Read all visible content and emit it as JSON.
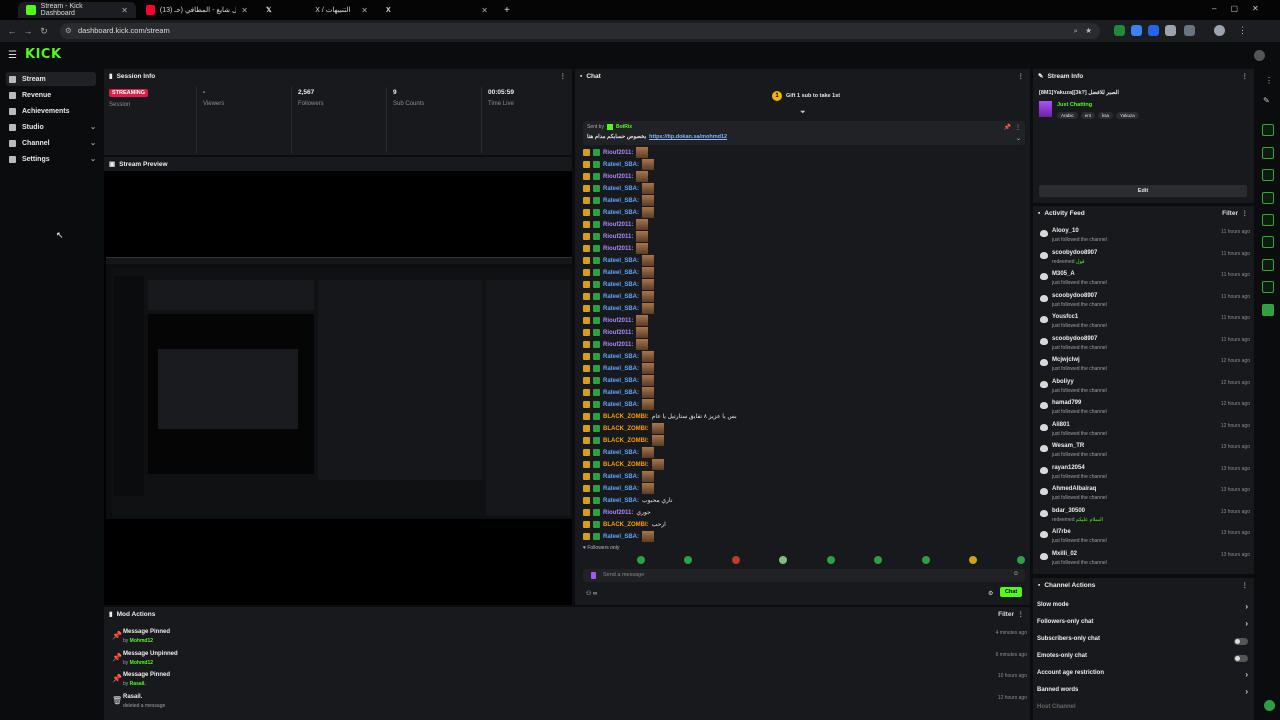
{
  "browser": {
    "tabs": [
      {
        "label": "Stream - Kick Dashboard",
        "color": "#53fc18"
      },
      {
        "label": "(13) مشعل شايع - المطافي (حـ...",
        "color": "#ff0033"
      },
      {
        "label": "X / التنبيهات",
        "color": "#ffffff"
      },
      {
        "label": "X",
        "color": "#ffffff"
      }
    ],
    "new_tab": "+",
    "url": "dashboard.kick.com/stream"
  },
  "logo": "KICK",
  "sidebar": {
    "items": [
      {
        "label": "Stream",
        "active": true
      },
      {
        "label": "Revenue"
      },
      {
        "label": "Achievements"
      },
      {
        "label": "Studio",
        "chevron": true
      },
      {
        "label": "Channel",
        "chevron": true
      },
      {
        "label": "Settings",
        "chevron": true
      }
    ]
  },
  "session_info": {
    "title": "Session Info",
    "badge": "STREAMING",
    "session_label": "Session",
    "stats": [
      {
        "value": "-",
        "label": "Viewers"
      },
      {
        "value": "2,567",
        "label": "Followers"
      },
      {
        "value": "9",
        "label": "Sub Counts"
      },
      {
        "value": "00:05:59",
        "label": "Time Live"
      }
    ]
  },
  "stream_preview": {
    "title": "Stream Preview"
  },
  "chat": {
    "title": "Chat",
    "gift_text": "Gift 1 sub to take 1st",
    "pinned_sender": "Sent by",
    "pinned_bot": "BotRix",
    "pinned_message": "بخصوص حسابكم مدام هنا",
    "pinned_link": "https://tip.dokan.sa/mohmd12",
    "rows": [
      {
        "name": "Riouf2011:",
        "color": "#a78bfa"
      },
      {
        "name": "Rateel_SBA:",
        "color": "#60a5fa"
      },
      {
        "name": "Riouf2011:",
        "color": "#a78bfa"
      },
      {
        "name": "Rateel_SBA:",
        "color": "#60a5fa"
      },
      {
        "name": "Rateel_SBA:",
        "color": "#60a5fa"
      },
      {
        "name": "Rateel_SBA:",
        "color": "#60a5fa"
      },
      {
        "name": "Riouf2011:",
        "color": "#a78bfa"
      },
      {
        "name": "Riouf2011:",
        "color": "#a78bfa"
      },
      {
        "name": "Riouf2011:",
        "color": "#a78bfa"
      },
      {
        "name": "Rateel_SBA:",
        "color": "#60a5fa"
      },
      {
        "name": "Rateel_SBA:",
        "color": "#60a5fa"
      },
      {
        "name": "Rateel_SBA:",
        "color": "#60a5fa"
      },
      {
        "name": "Rateel_SBA:",
        "color": "#60a5fa"
      },
      {
        "name": "Rateel_SBA:",
        "color": "#60a5fa"
      },
      {
        "name": "Riouf2011:",
        "color": "#a78bfa"
      },
      {
        "name": "Riouf2011:",
        "color": "#a78bfa"
      },
      {
        "name": "Riouf2011:",
        "color": "#a78bfa"
      },
      {
        "name": "Rateel_SBA:",
        "color": "#60a5fa"
      },
      {
        "name": "Rateel_SBA:",
        "color": "#60a5fa"
      },
      {
        "name": "Rateel_SBA:",
        "color": "#60a5fa"
      },
      {
        "name": "Rateel_SBA:",
        "color": "#60a5fa"
      },
      {
        "name": "Rateel_SBA:",
        "color": "#60a5fa"
      },
      {
        "name": "BLACK_ZOMBI:",
        "color": "#f59e0b",
        "text": "بس يا عزيز ٨ تقايق ستارتيل يا عام"
      },
      {
        "name": "BLACK_ZOMBI:",
        "color": "#f59e0b"
      },
      {
        "name": "BLACK_ZOMBI:",
        "color": "#f59e0b"
      },
      {
        "name": "Rateel_SBA:",
        "color": "#60a5fa"
      },
      {
        "name": "BLACK_ZOMBI:",
        "color": "#f59e0b"
      },
      {
        "name": "Rateel_SBA:",
        "color": "#60a5fa"
      },
      {
        "name": "Rateel_SBA:",
        "color": "#60a5fa"
      },
      {
        "name": "Rateel_SBA:",
        "color": "#60a5fa",
        "text": "تاري محبوب"
      },
      {
        "name": "Riouf2011:",
        "color": "#a78bfa",
        "text": "جوري"
      },
      {
        "name": "BLACK_ZOMBI:",
        "color": "#f59e0b",
        "text": "ارحب"
      },
      {
        "name": "Rateel_SBA:",
        "color": "#60a5fa"
      }
    ],
    "followers_only": "Followers only",
    "input_placeholder": "Send a message",
    "send_label": "Chat"
  },
  "stream_info": {
    "title": "Stream Info",
    "stream_title": "[8M1]Yakuza|[3k?] الصبر للافضل",
    "category": "Just Chatting",
    "tags": [
      "Arabic",
      "ent",
      "ksa",
      "Yakuza"
    ],
    "edit_label": "Edit"
  },
  "activity_feed": {
    "title": "Activity Feed",
    "filter_label": "Filter",
    "items": [
      {
        "name": "Alooy_10",
        "desc": "just followed the channel",
        "time": "11 hours ago"
      },
      {
        "name": "scoobydoo8907",
        "desc": "redeemed",
        "reward": "قول",
        "time": "11 hours ago"
      },
      {
        "name": "M305_A",
        "desc": "just followed the channel",
        "time": "11 hours ago"
      },
      {
        "name": "scoobydoo8907",
        "desc": "just followed the channel",
        "time": "11 hours ago"
      },
      {
        "name": "Yousfcc1",
        "desc": "just followed the channel",
        "time": "11 hours ago"
      },
      {
        "name": "scoobydoo8907",
        "desc": "just followed the channel",
        "time": "11 hours ago"
      },
      {
        "name": "Mcjwjclwj",
        "desc": "just followed the channel",
        "time": "12 hours ago"
      },
      {
        "name": "Aboliyy",
        "desc": "just followed the channel",
        "time": "12 hours ago"
      },
      {
        "name": "hamad799",
        "desc": "just followed the channel",
        "time": "12 hours ago"
      },
      {
        "name": "Ali801",
        "desc": "just followed the channel",
        "time": "12 hours ago"
      },
      {
        "name": "Wesam_TR",
        "desc": "just followed the channel",
        "time": "13 hours ago"
      },
      {
        "name": "rayan12054",
        "desc": "just followed the channel",
        "time": "13 hours ago"
      },
      {
        "name": "AhmedAlbairaq",
        "desc": "just followed the channel",
        "time": "13 hours ago"
      },
      {
        "name": "bdar_30500",
        "desc": "redeemed",
        "reward": "السلام عليكم",
        "time": "13 hours ago"
      },
      {
        "name": "Al7rbe",
        "desc": "just followed the channel",
        "time": "13 hours ago"
      },
      {
        "name": "Mxilli_02",
        "desc": "just followed the channel",
        "time": "13 hours ago"
      }
    ]
  },
  "channel_actions": {
    "title": "Channel Actions",
    "items": [
      {
        "label": "Slow mode",
        "type": "arrow"
      },
      {
        "label": "Followers-only chat",
        "type": "arrow"
      },
      {
        "label": "Subscribers-only chat",
        "type": "toggle"
      },
      {
        "label": "Emotes-only chat",
        "type": "toggle"
      },
      {
        "label": "Account age restriction",
        "type": "arrow"
      },
      {
        "label": "Banned words",
        "type": "arrow"
      },
      {
        "label": "Host Channel",
        "type": "none"
      }
    ]
  },
  "mod_actions": {
    "title": "Mod Actions",
    "filter_label": "Filter",
    "items": [
      {
        "action": "Message Pinned",
        "by": "by",
        "who": "Mohmd12",
        "time": "4 minutes ago"
      },
      {
        "action": "Message Unpinned",
        "by": "by",
        "who": "Mohmd12",
        "time": "6 minutes ago"
      },
      {
        "action": "Message Pinned",
        "by": "by",
        "who": "Rasail.",
        "time": "10 hours ago"
      },
      {
        "action": "Rasail.",
        "by": "deleted a message",
        "who": "",
        "time": "12 hours ago"
      }
    ]
  }
}
